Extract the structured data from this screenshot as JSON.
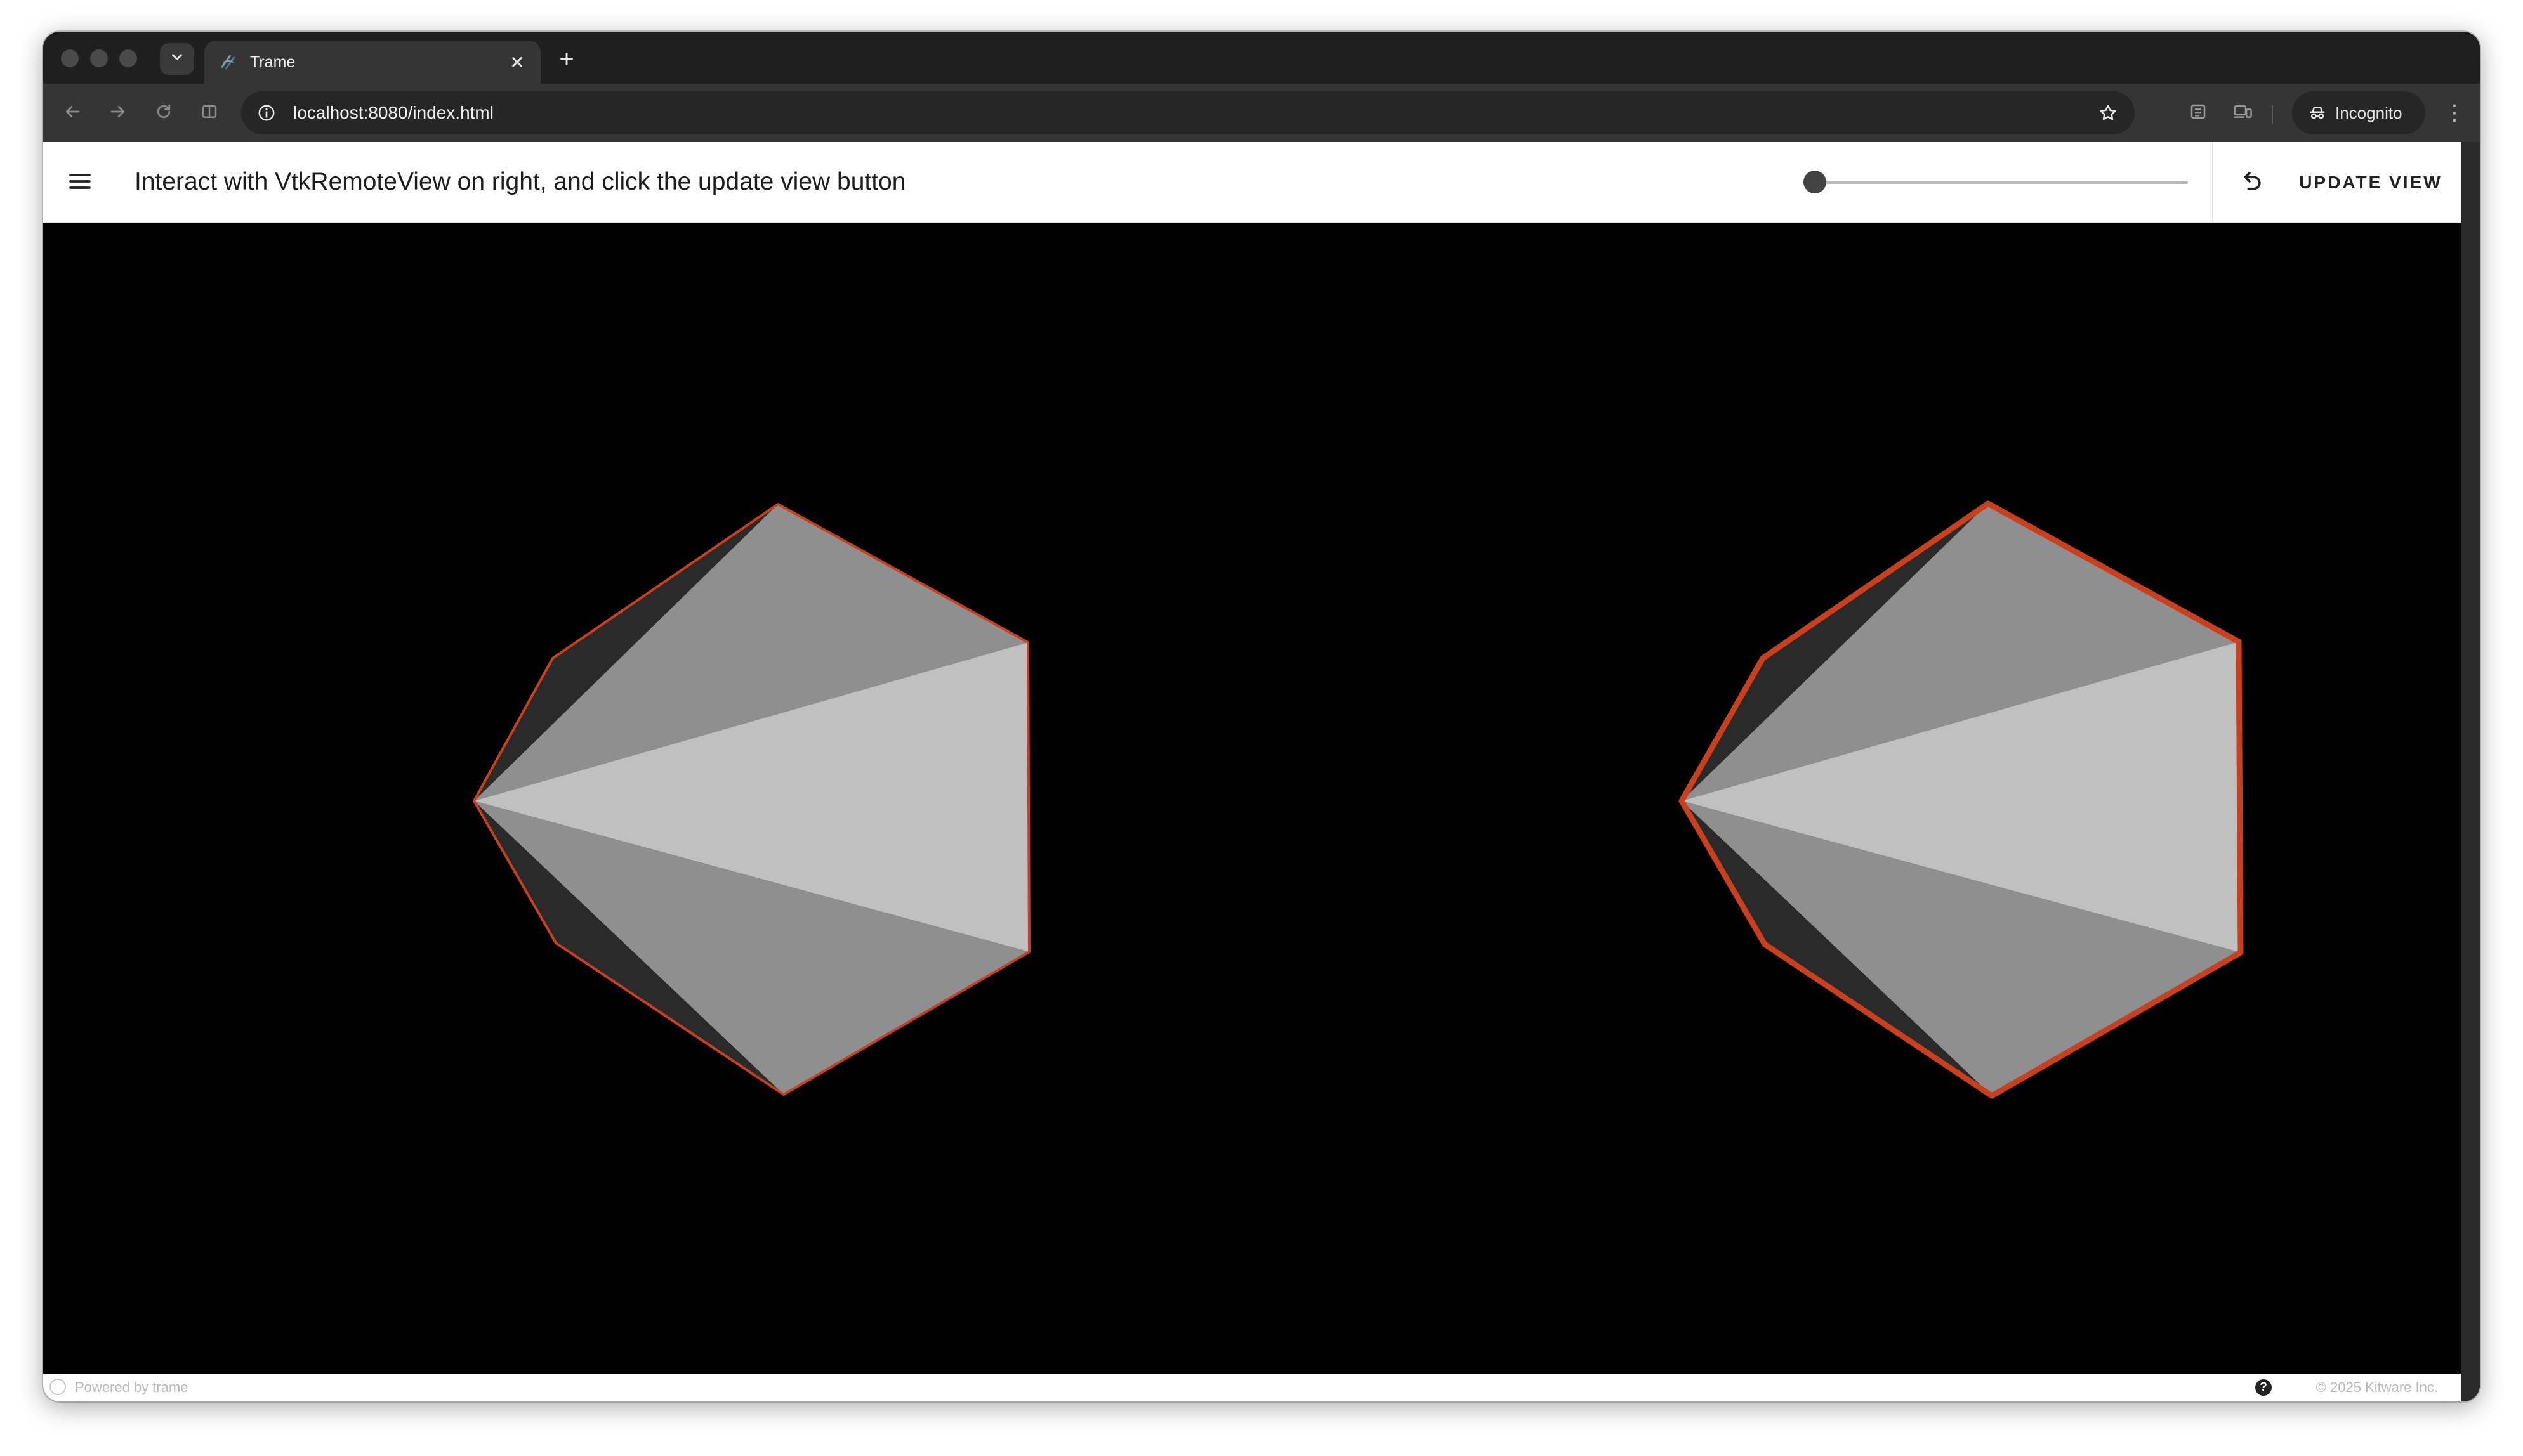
{
  "browser": {
    "tab": {
      "title": "Trame"
    },
    "address_bar": {
      "url": "localhost:8080/index.html"
    },
    "profile": {
      "label": "Incognito"
    }
  },
  "app": {
    "title": "Interact with VtkRemoteView on right, and click the update view button",
    "slider": {
      "value_fraction": 0.02
    },
    "update_button_label": "UPDATE VIEW"
  },
  "footer": {
    "powered_by": "Powered by trame",
    "help_glyph": "?",
    "copyright": "© 2025 Kitware Inc."
  },
  "colors": {
    "edge": "#c8401e",
    "face_dark": "#2a2a2a",
    "face_mid": "#8f8f8f",
    "face_light": "#c0c0c0",
    "background": "#000000"
  }
}
